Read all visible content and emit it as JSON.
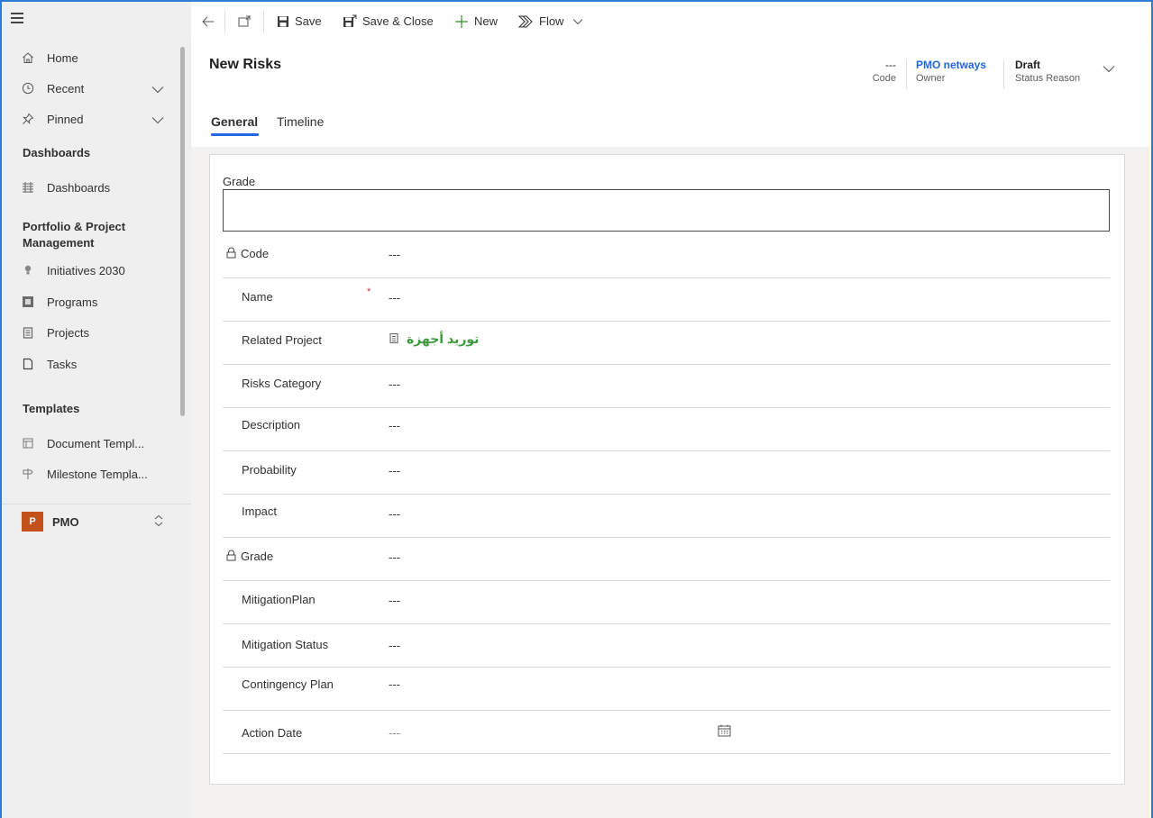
{
  "sidebar": {
    "nav": [
      {
        "label": "Home",
        "icon": "home-icon"
      },
      {
        "label": "Recent",
        "icon": "clock-icon"
      },
      {
        "label": "Pinned",
        "icon": "pin-icon"
      }
    ],
    "dashboards_header": "Dashboards",
    "dashboards_item": "Dashboards",
    "ppm_header_line1": "Portfolio & Project",
    "ppm_header_line2": "Management",
    "ppm_items": [
      {
        "label": "Initiatives 2030"
      },
      {
        "label": "Programs"
      },
      {
        "label": "Projects"
      },
      {
        "label": "Tasks"
      }
    ],
    "templates_header": "Templates",
    "template_items": [
      {
        "label": "Document Templ..."
      },
      {
        "label": "Milestone Templa..."
      }
    ],
    "area": {
      "initial": "P",
      "name": "PMO",
      "color": "#c4501a"
    }
  },
  "commandbar": {
    "save": "Save",
    "save_close": "Save & Close",
    "new": "New",
    "flow": "Flow"
  },
  "header": {
    "title": "New Risks",
    "fields": [
      {
        "value": "---",
        "label": "Code"
      },
      {
        "value": "PMO netways",
        "label": "Owner"
      },
      {
        "value": "Draft",
        "label": "Status Reason"
      }
    ],
    "tabs": [
      "General",
      "Timeline"
    ]
  },
  "form": {
    "grade_textbox_label": "Grade",
    "rows": [
      {
        "label": "Code",
        "value": "---",
        "locked": true
      },
      {
        "label": "Name",
        "value": "---",
        "required": "*"
      },
      {
        "label": "Related Project",
        "value": "توريد أجهزة"
      },
      {
        "label": "Risks Category",
        "value": "---"
      },
      {
        "label": "Description",
        "value": "---"
      },
      {
        "label": "Probability",
        "value": "---"
      },
      {
        "label": "Impact",
        "value": "---"
      },
      {
        "label": "Grade",
        "value": "---",
        "locked": true
      },
      {
        "label": "MitigationPlan",
        "value": "---"
      },
      {
        "label": "Mitigation Status",
        "value": "---"
      },
      {
        "label": "Contingency Plan",
        "value": "---"
      },
      {
        "label": "Action Date",
        "value": "---"
      }
    ]
  },
  "colors": {
    "accent": "#2266e3",
    "link": "#3c9a3c",
    "owner": "#2266e3",
    "required": "#d13438"
  }
}
